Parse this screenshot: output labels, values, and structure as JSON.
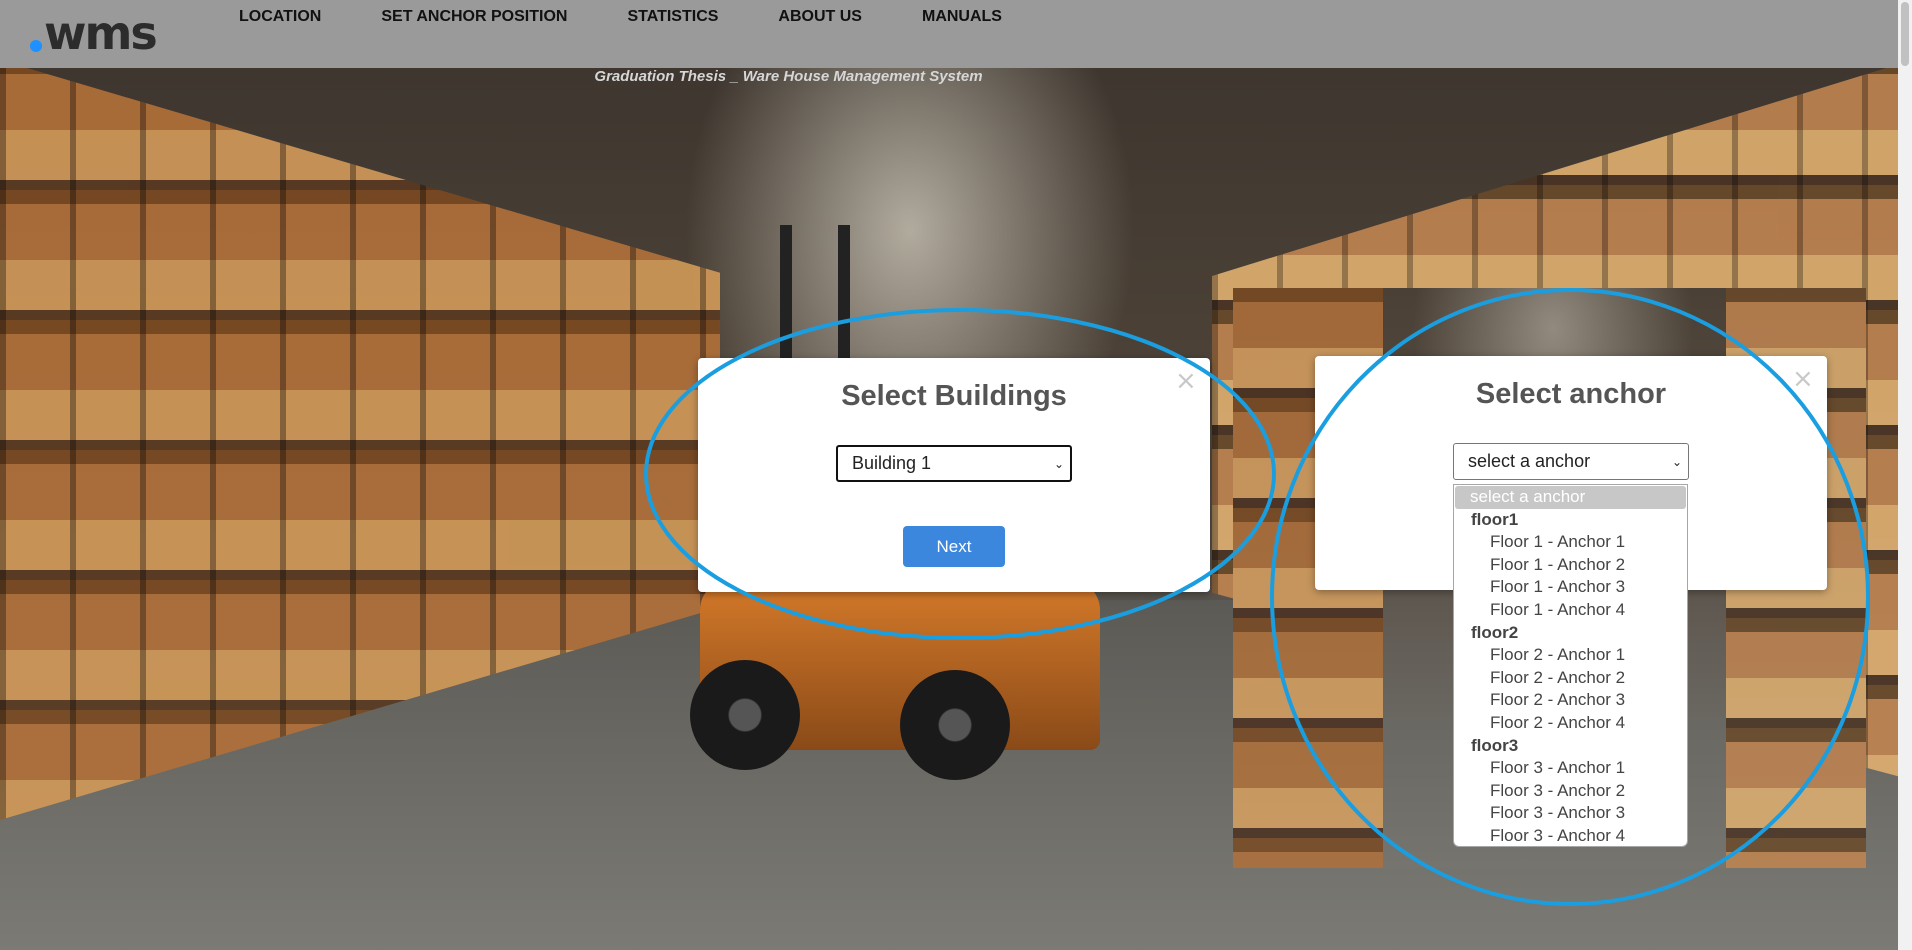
{
  "app": {
    "logo_text": "wms",
    "subtitle": "Graduation Thesis _ Ware House Management System"
  },
  "nav": {
    "items": [
      {
        "label": "LOCATION"
      },
      {
        "label": "SET ANCHOR POSITION"
      },
      {
        "label": "STATISTICS"
      },
      {
        "label": "ABOUT US"
      },
      {
        "label": "MANUALS"
      }
    ]
  },
  "building_modal": {
    "title": "Select Buildings",
    "close_icon": "×",
    "select_value": "Building 1",
    "next_label": "Next"
  },
  "anchor_modal": {
    "title": "Select anchor",
    "close_icon": "×",
    "select_value": "select a anchor",
    "dropdown": {
      "selected_label": "select a anchor",
      "groups": [
        {
          "label": "floor1",
          "options": [
            "Floor 1 - Anchor 1",
            "Floor 1 - Anchor 2",
            "Floor 1 - Anchor 3",
            "Floor 1 - Anchor 4"
          ]
        },
        {
          "label": "floor2",
          "options": [
            "Floor 2 - Anchor 1",
            "Floor 2 - Anchor 2",
            "Floor 2 - Anchor 3",
            "Floor 2 - Anchor 4"
          ]
        },
        {
          "label": "floor3",
          "options": [
            "Floor 3 - Anchor 1",
            "Floor 3 - Anchor 2",
            "Floor 3 - Anchor 3",
            "Floor 3 - Anchor 4"
          ]
        }
      ]
    }
  },
  "colors": {
    "navbar": "#9a9a9a",
    "primary_button": "#3a87dd",
    "annotation": "#1a9ee0",
    "logo_dot": "#1e90ff"
  }
}
